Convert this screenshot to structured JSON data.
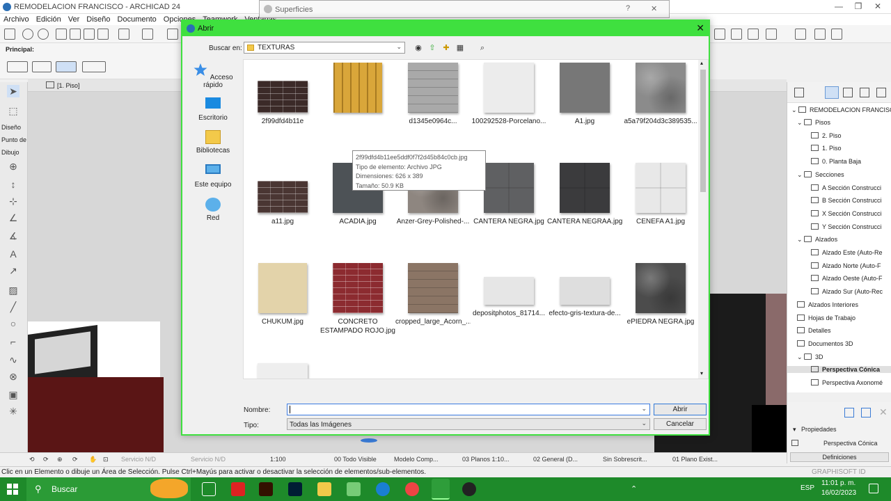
{
  "app": {
    "title": "REMODELACION FRANCISCO - ARCHICAD 24",
    "menu": [
      "Archivo",
      "Edición",
      "Ver",
      "Diseño",
      "Documento",
      "Opciones",
      "Teamwork",
      "Ventanas"
    ],
    "toolbox_labels": {
      "principal": "Principal:",
      "diseno": "Diseño",
      "punto_de": "Punto de",
      "dibujo": "Dibujo"
    },
    "view_tab": "[1. Piso]"
  },
  "background_dialog": {
    "title": "Superficies",
    "help": "?",
    "close": "✕"
  },
  "dialog": {
    "title": "Abrir",
    "look_in_label": "Buscar en:",
    "look_in_value": "TEXTURAS",
    "places": [
      {
        "label": "Acceso rápido",
        "icon": "star-icon"
      },
      {
        "label": "Escritorio",
        "icon": "desktop-icon"
      },
      {
        "label": "Bibliotecas",
        "icon": "libraries-icon"
      },
      {
        "label": "Este equipo",
        "icon": "computer-icon"
      },
      {
        "label": "Red",
        "icon": "network-icon"
      }
    ],
    "files": [
      {
        "name": "2f99dfd4b11e",
        "color": "#3b2a28",
        "pattern": "brick"
      },
      {
        "name": "",
        "color": "#d9a63a",
        "pattern": "bamboo"
      },
      {
        "name": "d1345e0964c...",
        "color": "#a9a9a9",
        "pattern": "planks"
      },
      {
        "name": "100292528-Porcelano...",
        "color": "#ececec",
        "pattern": "plain"
      },
      {
        "name": "A1.jpg",
        "color": "#777777",
        "pattern": "plain"
      },
      {
        "name": "a5a79f204d3c389535...",
        "color": "#8b8b8b",
        "pattern": "stone"
      },
      {
        "name": "a11.jpg",
        "color": "#4a3633",
        "pattern": "brick"
      },
      {
        "name": "ACADIA.jpg",
        "color": "#4d5256",
        "pattern": "plain"
      },
      {
        "name": "Anzer-Grey-Polished-...",
        "color": "#8e8680",
        "pattern": "stone"
      },
      {
        "name": "CANTERA NEGRA.jpg",
        "color": "#5f6062",
        "pattern": "tiles"
      },
      {
        "name": "CANTERA NEGRAA.jpg",
        "color": "#3b3b3d",
        "pattern": "tiles"
      },
      {
        "name": "CENEFA A1.jpg",
        "color": "#e8e8e8",
        "pattern": "tiles"
      },
      {
        "name": "CHUKUM.jpg",
        "color": "#e3d3aa",
        "pattern": "plain"
      },
      {
        "name": "CONCRETO ESTAMPADO ROJO.jpg",
        "color": "#8c2b30",
        "pattern": "brick"
      },
      {
        "name": "cropped_large_Acorn_...",
        "color": "#8b7565",
        "pattern": "planks"
      },
      {
        "name": "depositphotos_81714...",
        "color": "#e6e6e6",
        "pattern": "plain"
      },
      {
        "name": "efecto-gris-textura-de...",
        "color": "#dedede",
        "pattern": "plain"
      },
      {
        "name": "ePIEDRA NEGRA.jpg",
        "color": "#4c4c4c",
        "pattern": "stone"
      },
      {
        "name": "",
        "color": "#eeeeee",
        "pattern": "plain"
      }
    ],
    "tooltip": {
      "file": "2f99dfd4b11ee5ddf0f7f2d45b84c0cb.jpg",
      "type": "Tipo de elemento: Archivo JPG",
      "dims": "Dimensiones: 626 x 389",
      "size": "Tamaño: 50.9 KB"
    },
    "name_label": "Nombre:",
    "name_value": "",
    "type_label": "Tipo:",
    "type_value": "Todas las Imágenes",
    "open_button": "Abrir",
    "cancel_button": "Cancelar"
  },
  "navigator": {
    "root": "REMODELACION FRANCISC",
    "items": [
      {
        "label": "Pisos",
        "level": 1,
        "icon": "folder"
      },
      {
        "label": "2. Piso",
        "level": 2
      },
      {
        "label": "1. Piso",
        "level": 2
      },
      {
        "label": "0. Planta Baja",
        "level": 2
      },
      {
        "label": "Secciones",
        "level": 1,
        "icon": "folder"
      },
      {
        "label": "A Sección Construcci",
        "level": 2
      },
      {
        "label": "B Sección Construcci",
        "level": 2
      },
      {
        "label": "X Sección Construcci",
        "level": 2
      },
      {
        "label": "Y Sección Construcci",
        "level": 2
      },
      {
        "label": "Alzados",
        "level": 1,
        "icon": "folder"
      },
      {
        "label": "Alzado Este (Auto-Re",
        "level": 2
      },
      {
        "label": "Alzado Norte (Auto-F",
        "level": 2
      },
      {
        "label": "Alzado Oeste (Auto-F",
        "level": 2
      },
      {
        "label": "Alzado Sur (Auto-Rec",
        "level": 2
      },
      {
        "label": "Alzados Interiores",
        "level": 1
      },
      {
        "label": "Hojas de Trabajo",
        "level": 1
      },
      {
        "label": "Detalles",
        "level": 1
      },
      {
        "label": "Documentos 3D",
        "level": 1
      },
      {
        "label": "3D",
        "level": 1,
        "icon": "folder"
      },
      {
        "label": "Perspectiva Cónica",
        "level": 2,
        "selected": true
      },
      {
        "label": "Perspectiva Axonomé",
        "level": 2
      }
    ],
    "properties_title": "Propiedades",
    "properties_value": "Perspectiva Cónica",
    "definitions": "Definiciones",
    "brand": "GRAPHISOFT ID"
  },
  "statusbar": {
    "service1": "Servicio N/D",
    "service2": "Servicio N/D",
    "scale": "1:100",
    "layer": "00 Todo Visible",
    "model": "Modelo Comp...",
    "plans": "03 Planos 1:10...",
    "general": "02 General (D...",
    "override": "Sin Sobrescrit...",
    "plan": "01 Plano Exist...",
    "hint": "Clic en un Elemento o dibuje un Área de Selección. Pulse Ctrl+Mayús para activar o desactivar la selección de elementos/sub-elementos."
  },
  "taskbar": {
    "search": "Buscar",
    "lang": "ESP",
    "time": "11:01 p. m.",
    "date": "16/02/2023"
  }
}
